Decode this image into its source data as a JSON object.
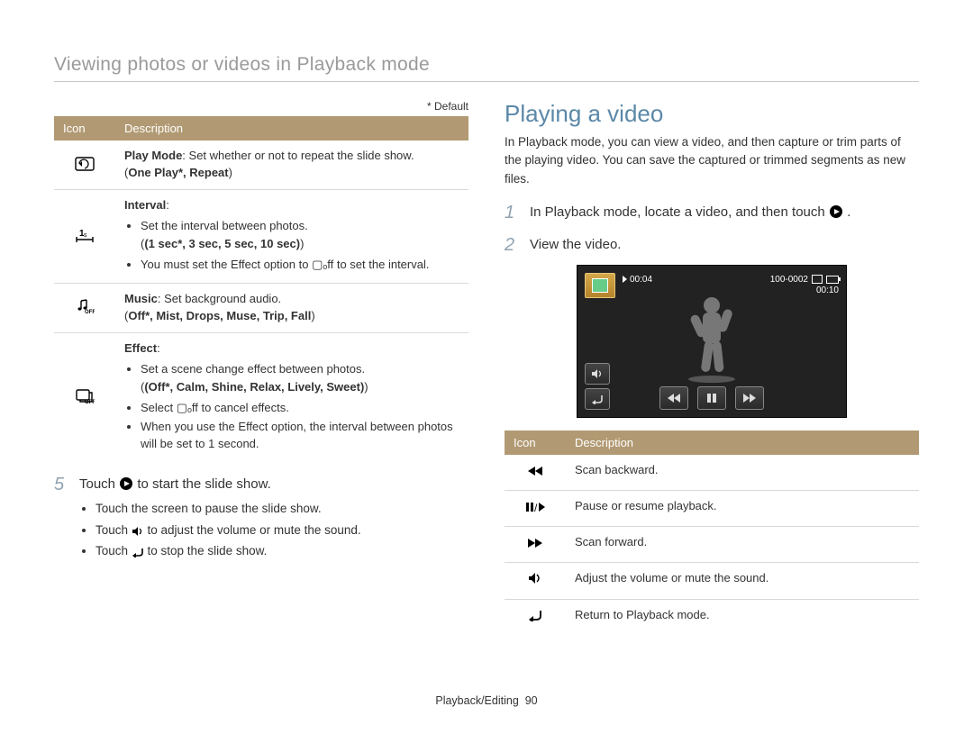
{
  "page_header": "Viewing photos or videos in Playback mode",
  "default_note": "* Default",
  "table1": {
    "head_icon": "Icon",
    "head_desc": "Description",
    "rows": [
      {
        "icon": "loop-icon",
        "title": "Play Mode",
        "body": ": Set whether or not to repeat the slide show.",
        "options": "One Play*, Repeat"
      },
      {
        "icon": "interval-icon",
        "title": "Interval",
        "body": ":",
        "bullets": [
          "Set the interval between photos.",
          "(1 sec*, 3 sec, 5 sec, 10 sec)",
          "You must set the Effect option to ▢ₒff to set the interval."
        ]
      },
      {
        "icon": "music-off-icon",
        "title": "Music",
        "body": ": Set background audio.",
        "options": "Off*, Mist, Drops, Muse, Trip, Fall"
      },
      {
        "icon": "effect-off-icon",
        "title": "Effect",
        "body": ":",
        "bullets": [
          "Set a scene change effect between photos.",
          "(Off*, Calm, Shine, Relax, Lively, Sweet)",
          "Select ▢ₒff to cancel effects.",
          "When you use the Effect option, the interval between photos will be set to 1 second."
        ]
      }
    ]
  },
  "step5": {
    "num": "5",
    "text_prefix": "Touch ",
    "text_suffix": " to start the slide show."
  },
  "step5_bullets": [
    "Touch the screen to pause the slide show.",
    "Touch 🔊 to adjust the volume or mute the sound.",
    "Touch ↶ to stop the slide show."
  ],
  "right": {
    "title": "Playing a video",
    "intro": "In Playback mode, you can view a video, and then capture or trim parts of the playing video. You can save the captured or trimmed segments as new files.",
    "step1": {
      "num": "1",
      "text_prefix": "In Playback mode, locate a video, and then touch ",
      "text_suffix": "."
    },
    "step2": {
      "num": "2",
      "text": "View the video."
    }
  },
  "player": {
    "time_elapsed": "00:04",
    "file_id": "100-0002",
    "time_total": "00:10"
  },
  "table2": {
    "head_icon": "Icon",
    "head_desc": "Description",
    "rows": [
      {
        "icon": "rewind-icon",
        "desc": "Scan backward."
      },
      {
        "icon": "play-pause-icon",
        "desc": "Pause or resume playback."
      },
      {
        "icon": "fastforward-icon",
        "desc": "Scan forward."
      },
      {
        "icon": "speaker-icon",
        "desc": "Adjust the volume or mute the sound."
      },
      {
        "icon": "return-icon",
        "desc": "Return to Playback mode."
      }
    ]
  },
  "footer": {
    "section": "Playback/Editing",
    "page": "90"
  }
}
